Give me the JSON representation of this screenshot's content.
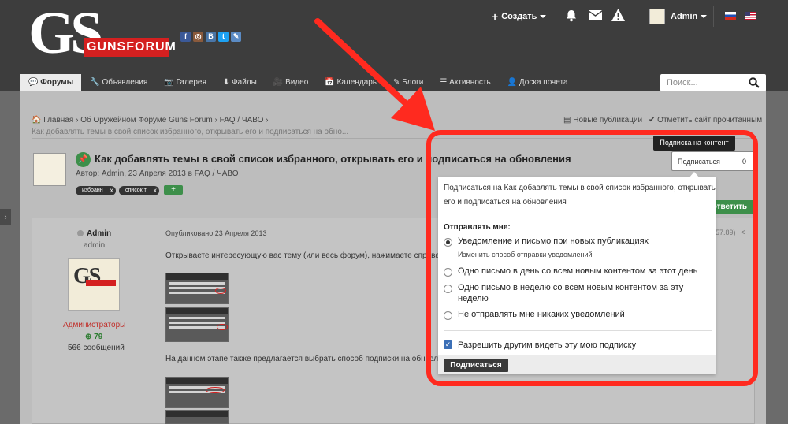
{
  "header": {
    "logo_text": "GS",
    "logo_banner": "GUNSFORUM",
    "social_icons": [
      "facebook-icon",
      "instagram-icon",
      "vk-icon",
      "twitter-icon",
      "odnoklassniki-icon"
    ],
    "create_label": "Создать",
    "username": "Admin"
  },
  "nav": {
    "tabs": [
      "Форумы",
      "Объявления",
      "Галерея",
      "Файлы",
      "Видео",
      "Календарь",
      "Блоги",
      "Активность",
      "Доска почета"
    ]
  },
  "search": {
    "placeholder": "Поиск..."
  },
  "breadcrumb": {
    "home": "Главная",
    "forum": "Об Оружейном Форуме Guns Forum",
    "section": "FAQ / ЧАВО",
    "current": "Как добавлять темы в свой список избранного, открывать его и подписаться на обно..."
  },
  "actions": {
    "new_posts": "Новые публикации",
    "mark_read": "Отметить сайт прочитанным"
  },
  "topic": {
    "title": "Как добавлять темы в свой список избранного, открывать его и подписаться на обновления",
    "meta": "Автор: Admin, 23 Апреля 2013 в FAQ / ЧАВО",
    "tags": [
      "избранн",
      "список т"
    ],
    "subscribe_label": "Подписаться",
    "subscribe_count": "0",
    "tooltip": "Подписка на контент",
    "reply_label": "ответить"
  },
  "post": {
    "author": "Admin",
    "role": "admin",
    "group": "Администраторы",
    "reputation": "79",
    "post_count": "566 сообщений",
    "date": "Опубликовано 23 Апреля 2013",
    "text1": "Открываете интересующую вас тему (или весь форум), нажимаете справа",
    "text2": "На данном этапе также предлагается выбрать способ подписки на обновл",
    "post_id": "57.89)"
  },
  "popup": {
    "heading_line1": "Подписаться на Как добавлять темы в свой список избранного, открывать",
    "heading_line2": "его и подписаться на обновления",
    "send_label": "Отправлять мне:",
    "options": [
      {
        "label": "Уведомление и письмо при новых публикациях",
        "sub": "Изменить способ отправки уведомлений",
        "checked": true
      },
      {
        "label": "Одно письмо в день со всем новым контентом за этот день",
        "checked": false
      },
      {
        "label_line1": "Одно письмо в неделю со всем новым контентом за эту",
        "label_line2": "неделю",
        "checked": false
      },
      {
        "label": "Не отправлять мне никаких уведомлений",
        "checked": false
      }
    ],
    "allow_others": "Разрешить другим видеть эту мою подписку",
    "submit_label": "Подписаться"
  },
  "colors": {
    "header_bg": "#3d3d3d",
    "highlight_red": "#ff2a1f",
    "accent_green": "#3d8f4a"
  }
}
